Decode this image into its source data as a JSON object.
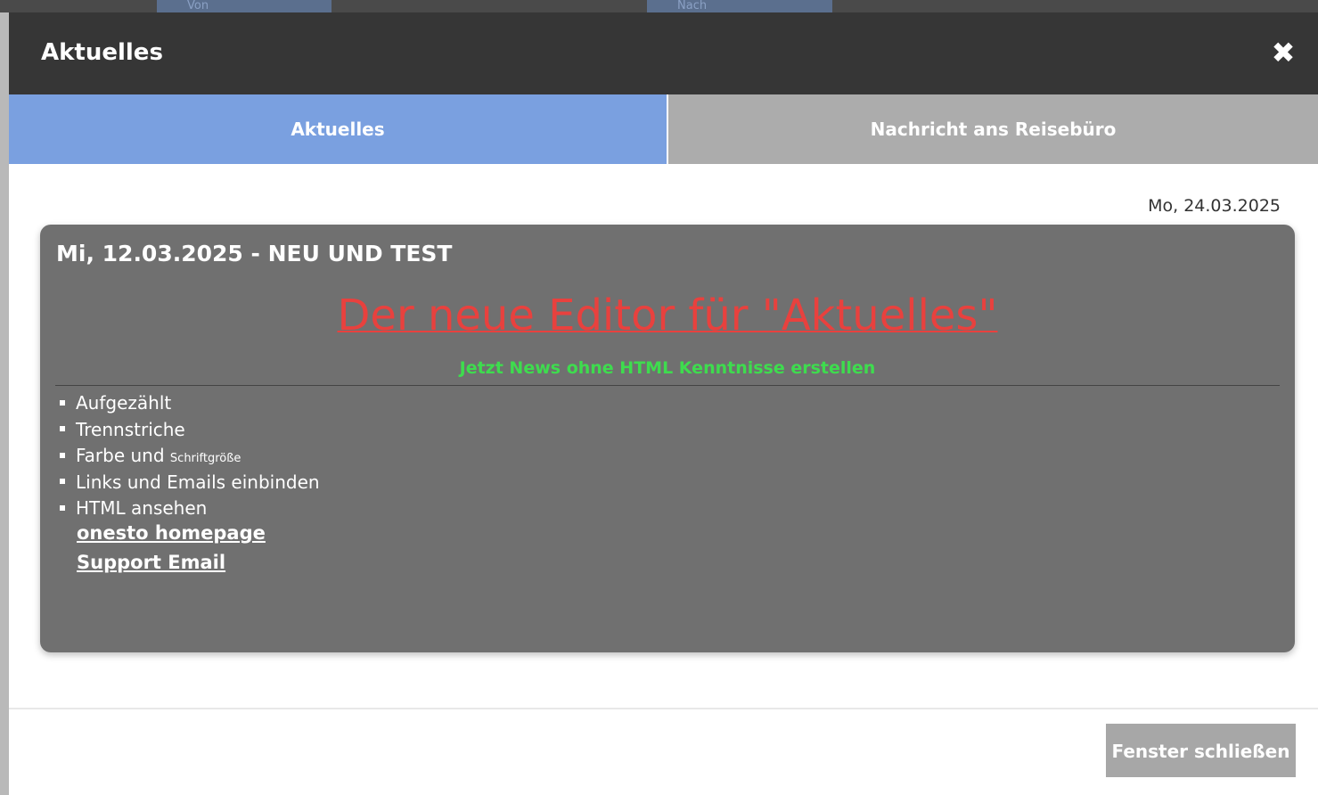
{
  "backdrop": {
    "tabs": [
      "Von",
      "Nach"
    ]
  },
  "modal": {
    "title": "Aktuelles",
    "close_icon": "close-icon"
  },
  "tabs": [
    {
      "label": "Aktuelles",
      "active": true
    },
    {
      "label": "Nachricht ans Reisebüro",
      "active": false
    }
  ],
  "current_date": "Mo, 24.03.2025",
  "news": {
    "heading": "Mi,  12.03.2025 - NEU UND TEST",
    "headline": "Der neue Editor für \"Aktuelles\"",
    "subheadline": "Jetzt News ohne HTML Kenntnisse erstellen",
    "features": [
      "Aufgezählt",
      "Trennstriche",
      "Farbe und",
      "Links und Emails einbinden",
      "HTML ansehen"
    ],
    "feature_small_suffix": "Schriftgröße",
    "links": [
      "onesto homepage",
      "Support Email"
    ]
  },
  "colors": {
    "header_bg": "#363636",
    "tab_active": "#7aa0e0",
    "tab_inactive": "#acacac",
    "card_bg": "#707070",
    "headline_red": "#e8413e",
    "subheadline_green": "#3edc4e",
    "button_bg": "#a7a7a7"
  },
  "footer": {
    "close_button": "Fenster schließen"
  }
}
